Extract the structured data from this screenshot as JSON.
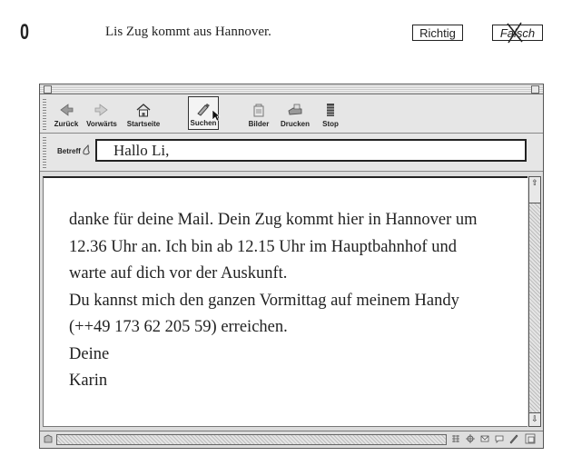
{
  "exercise": {
    "number": "0",
    "statement": "Lis Zug kommt aus Hannover.",
    "options": [
      "Richtig",
      "Falsch"
    ],
    "selected": "Falsch"
  },
  "toolbar": {
    "buttons": [
      {
        "label": "Zurück",
        "icon": "back-arrow-icon"
      },
      {
        "label": "Vorwärts",
        "icon": "forward-arrow-icon"
      },
      {
        "label": "Startseite",
        "icon": "home-icon"
      },
      {
        "label": "Suchen",
        "icon": "search-icon"
      },
      {
        "label": "Bilder",
        "icon": "images-icon"
      },
      {
        "label": "Drucken",
        "icon": "printer-icon"
      },
      {
        "label": "Stop",
        "icon": "stop-icon"
      }
    ]
  },
  "subject": {
    "label": "Betreff",
    "value": "Hallo Li,"
  },
  "mail": {
    "lines": [
      "danke für deine Mail. Dein Zug kommt hier in Hannover um",
      "12.36 Uhr an. Ich bin ab 12.15 Uhr im Hauptbahnhof und",
      "warte auf dich vor der Auskunft.",
      "Du kannst mich den ganzen Vormittag auf meinem Handy",
      "(++49 173 62 205 59) erreichen.",
      "Deine",
      "Karin"
    ]
  },
  "colors": {
    "window_bg": "#dcdcdc",
    "text": "#222222"
  }
}
